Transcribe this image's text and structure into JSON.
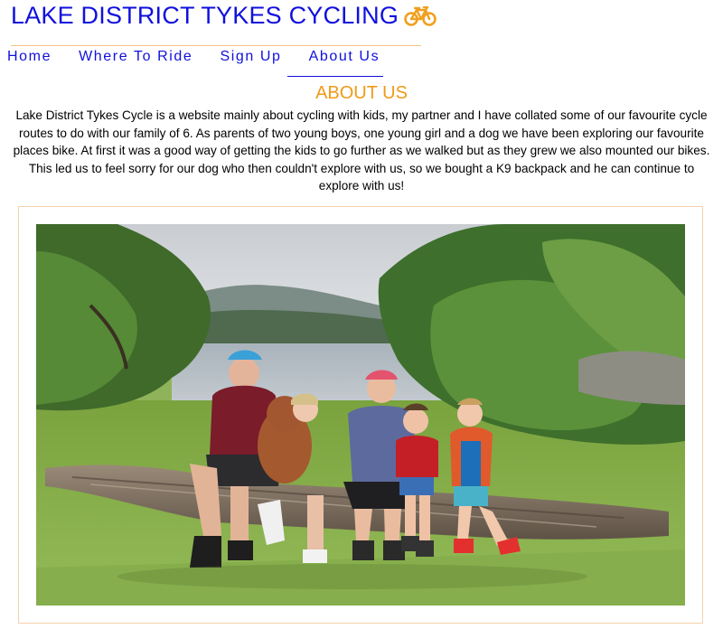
{
  "site": {
    "title": "LAKE DISTRICT TYKES CYCLING",
    "title_icon": "bicycle-icon"
  },
  "nav": {
    "items": [
      {
        "label": "Home"
      },
      {
        "label": "Where To Ride"
      },
      {
        "label": "Sign Up"
      },
      {
        "label": "About Us",
        "active": true
      }
    ]
  },
  "about": {
    "heading": "ABOUT US",
    "body": "Lake District Tykes Cycle is a website mainly about cycling with kids, my partner and I have collated some of our favourite cycle routes to do with our family of 6.  As parents of two young boys, one young girl and a dog we have been exploring our favourite places bike. At first it was a good way of getting the kids to go further as we walked but as they grew we also mounted our bikes. This led us to feel sorry for our dog who then couldn't explore with us, so we bought a K9 backpack and he can continue to explore with us!"
  },
  "photo": {
    "subject": "family-photo-by-lake"
  },
  "colors": {
    "title_blue": "#1010dd",
    "heading_orange": "#f09a17",
    "rule_peach": "#f2c48a"
  }
}
